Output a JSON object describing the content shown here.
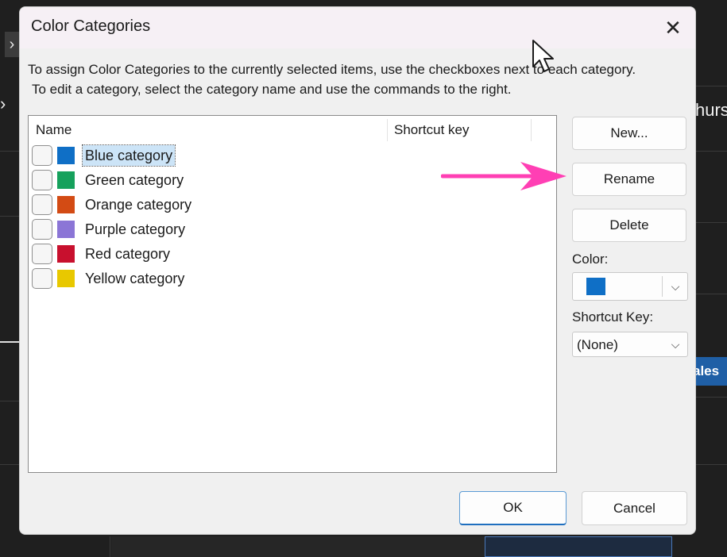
{
  "background": {
    "chevron": "›",
    "partial_day_label": "hurs",
    "partial_event_label": "ales"
  },
  "dialog": {
    "title": "Color Categories",
    "close_glyph": "✕",
    "instruction_line1": "To assign Color Categories to the currently selected items, use the checkboxes next to each category.",
    "instruction_line2": "To edit a category, select the category name and use the commands to the right.",
    "columns": {
      "name": "Name",
      "shortcut": "Shortcut key"
    },
    "categories": [
      {
        "label": "Blue category",
        "color": "#0f6fc6",
        "selected": true,
        "checked": false
      },
      {
        "label": "Green category",
        "color": "#16a15c",
        "selected": false,
        "checked": false
      },
      {
        "label": "Orange category",
        "color": "#d34b14",
        "selected": false,
        "checked": false
      },
      {
        "label": "Purple category",
        "color": "#8b75d6",
        "selected": false,
        "checked": false
      },
      {
        "label": "Red category",
        "color": "#c8102e",
        "selected": false,
        "checked": false
      },
      {
        "label": "Yellow category",
        "color": "#e8c800",
        "selected": false,
        "checked": false
      }
    ],
    "buttons": {
      "new": "New...",
      "rename": "Rename",
      "delete": "Delete",
      "ok": "OK",
      "cancel": "Cancel"
    },
    "color_label": "Color:",
    "color_value": "#0f6fc6",
    "shortcut_label": "Shortcut Key:",
    "shortcut_value": "(None)"
  },
  "annotation": {
    "arrow_color": "#ff3fb4"
  }
}
